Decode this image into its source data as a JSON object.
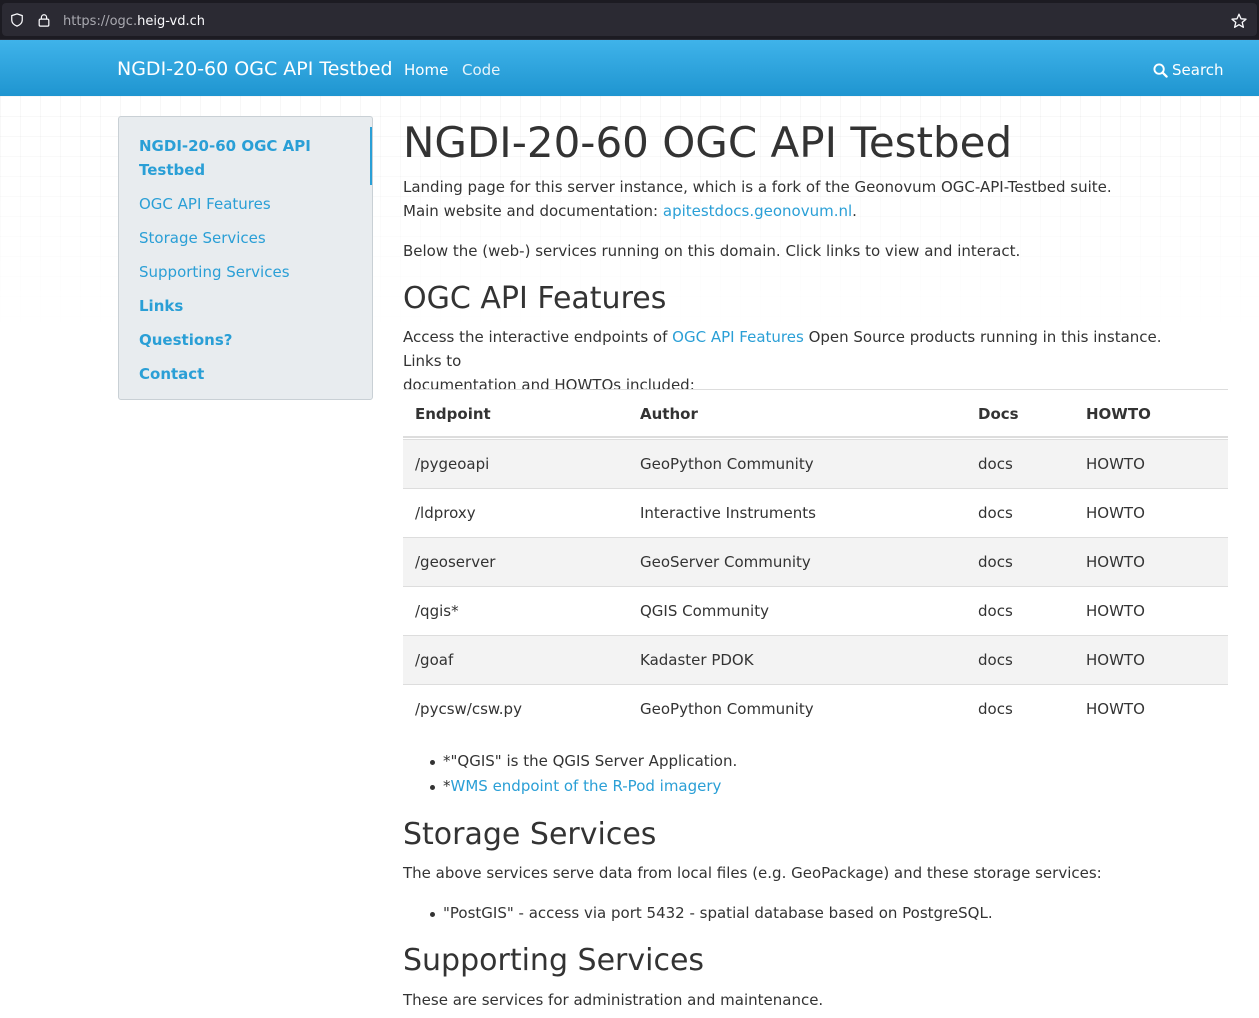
{
  "browser": {
    "url_scheme": "https://ogc.",
    "url_host": "heig-vd.ch"
  },
  "navbar": {
    "brand": "NGDI-20-60 OGC API Testbed",
    "links": [
      "Home",
      "Code"
    ],
    "search_label": "Search"
  },
  "sidebar": {
    "title_line1": "NGDI-20-60 OGC API",
    "title_line2": "Testbed",
    "items": [
      "OGC API Features",
      "Storage Services",
      "Supporting Services",
      "Links",
      "Questions?",
      "Contact"
    ]
  },
  "main": {
    "title": "NGDI-20-60 OGC API Testbed",
    "intro_line1": "Landing page for this server instance, which is a fork of the Geonovum OGC-API-Testbed suite.",
    "intro_line2_prefix": "Main website and documentation: ",
    "intro_link": "apitestdocs.geonovum.nl",
    "intro_line2_suffix": ".",
    "services_note": "Below the (web-) services running on this domain. Click links to view and interact.",
    "features": {
      "heading": "OGC API Features",
      "text_prefix": "Access the interactive endpoints of ",
      "text_link": "OGC API Features",
      "text_suffix": " Open Source products running in this instance. Links to",
      "text_line2": "documentation and HOWTOs included:",
      "columns": [
        "Endpoint",
        "Author",
        "Docs",
        "HOWTO"
      ],
      "rows": [
        {
          "endpoint": "/pygeoapi",
          "author": "GeoPython Community",
          "author_link": true,
          "docs": "docs",
          "howto": "HOWTO"
        },
        {
          "endpoint": "/ldproxy",
          "author": "Interactive Instruments",
          "author_link": false,
          "docs": "docs",
          "howto": "HOWTO"
        },
        {
          "endpoint": "/geoserver",
          "author": "GeoServer Community",
          "author_link": false,
          "docs": "docs",
          "howto": "HOWTO"
        },
        {
          "endpoint": "/qgis*",
          "author": "QGIS Community",
          "author_link": false,
          "docs": "docs",
          "howto": "HOWTO"
        },
        {
          "endpoint": "/goaf",
          "author": "Kadaster PDOK",
          "author_link": false,
          "docs": "docs",
          "howto": "HOWTO"
        },
        {
          "endpoint": "/pycsw/csw.py",
          "author": "GeoPython Community",
          "author_link": true,
          "docs": "docs",
          "howto": "HOWTO"
        }
      ],
      "footnote1": "*\"QGIS\" is the QGIS Server Application.",
      "footnote2_prefix": "*",
      "footnote2_link": "WMS endpoint of the R-Pod imagery"
    },
    "storage": {
      "heading": "Storage Services",
      "text": "The above services serve data from local files (e.g. GeoPackage) and these storage services:",
      "bullet": "\"PostGIS\" - access via port 5432 - spatial database based on PostgreSQL."
    },
    "supporting": {
      "heading": "Supporting Services",
      "text": "These are services for administration and maintenance."
    }
  }
}
